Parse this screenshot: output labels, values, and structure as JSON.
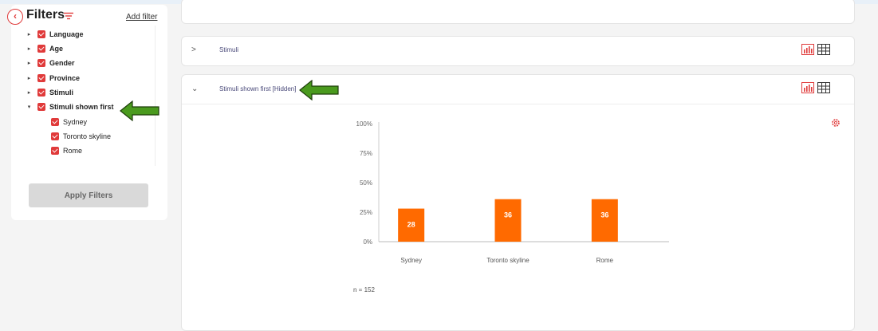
{
  "sidebar": {
    "title": "Filters",
    "add_filter": "Add filter",
    "apply_label": "Apply Filters",
    "filters": [
      {
        "label": "Language",
        "expanded": false
      },
      {
        "label": "Age",
        "expanded": false
      },
      {
        "label": "Gender",
        "expanded": false
      },
      {
        "label": "Province",
        "expanded": false
      },
      {
        "label": "Stimuli",
        "expanded": false
      },
      {
        "label": "Stimuli shown first",
        "expanded": true
      }
    ],
    "sub_options": [
      "Sydney",
      "Toronto skyline",
      "Rome"
    ]
  },
  "cards": {
    "stimuli_title": "Stimuli",
    "shown_first_title": "Stimuli shown first [Hidden]"
  },
  "icons": {
    "chart": "bar-chart-icon",
    "table": "table-grid-icon",
    "settings": "gear-icon"
  },
  "colors": {
    "accent": "#e03a3a",
    "bar": "#ff6a00",
    "arrow": "#4a9a1e"
  },
  "chart_data": {
    "type": "bar",
    "categories": [
      "Sydney",
      "Toronto skyline",
      "Rome"
    ],
    "values": [
      28,
      36,
      36
    ],
    "ylim": [
      0,
      100
    ],
    "yticks": [
      "0%",
      "25%",
      "50%",
      "75%",
      "100%"
    ],
    "n_label": "n = 152"
  }
}
